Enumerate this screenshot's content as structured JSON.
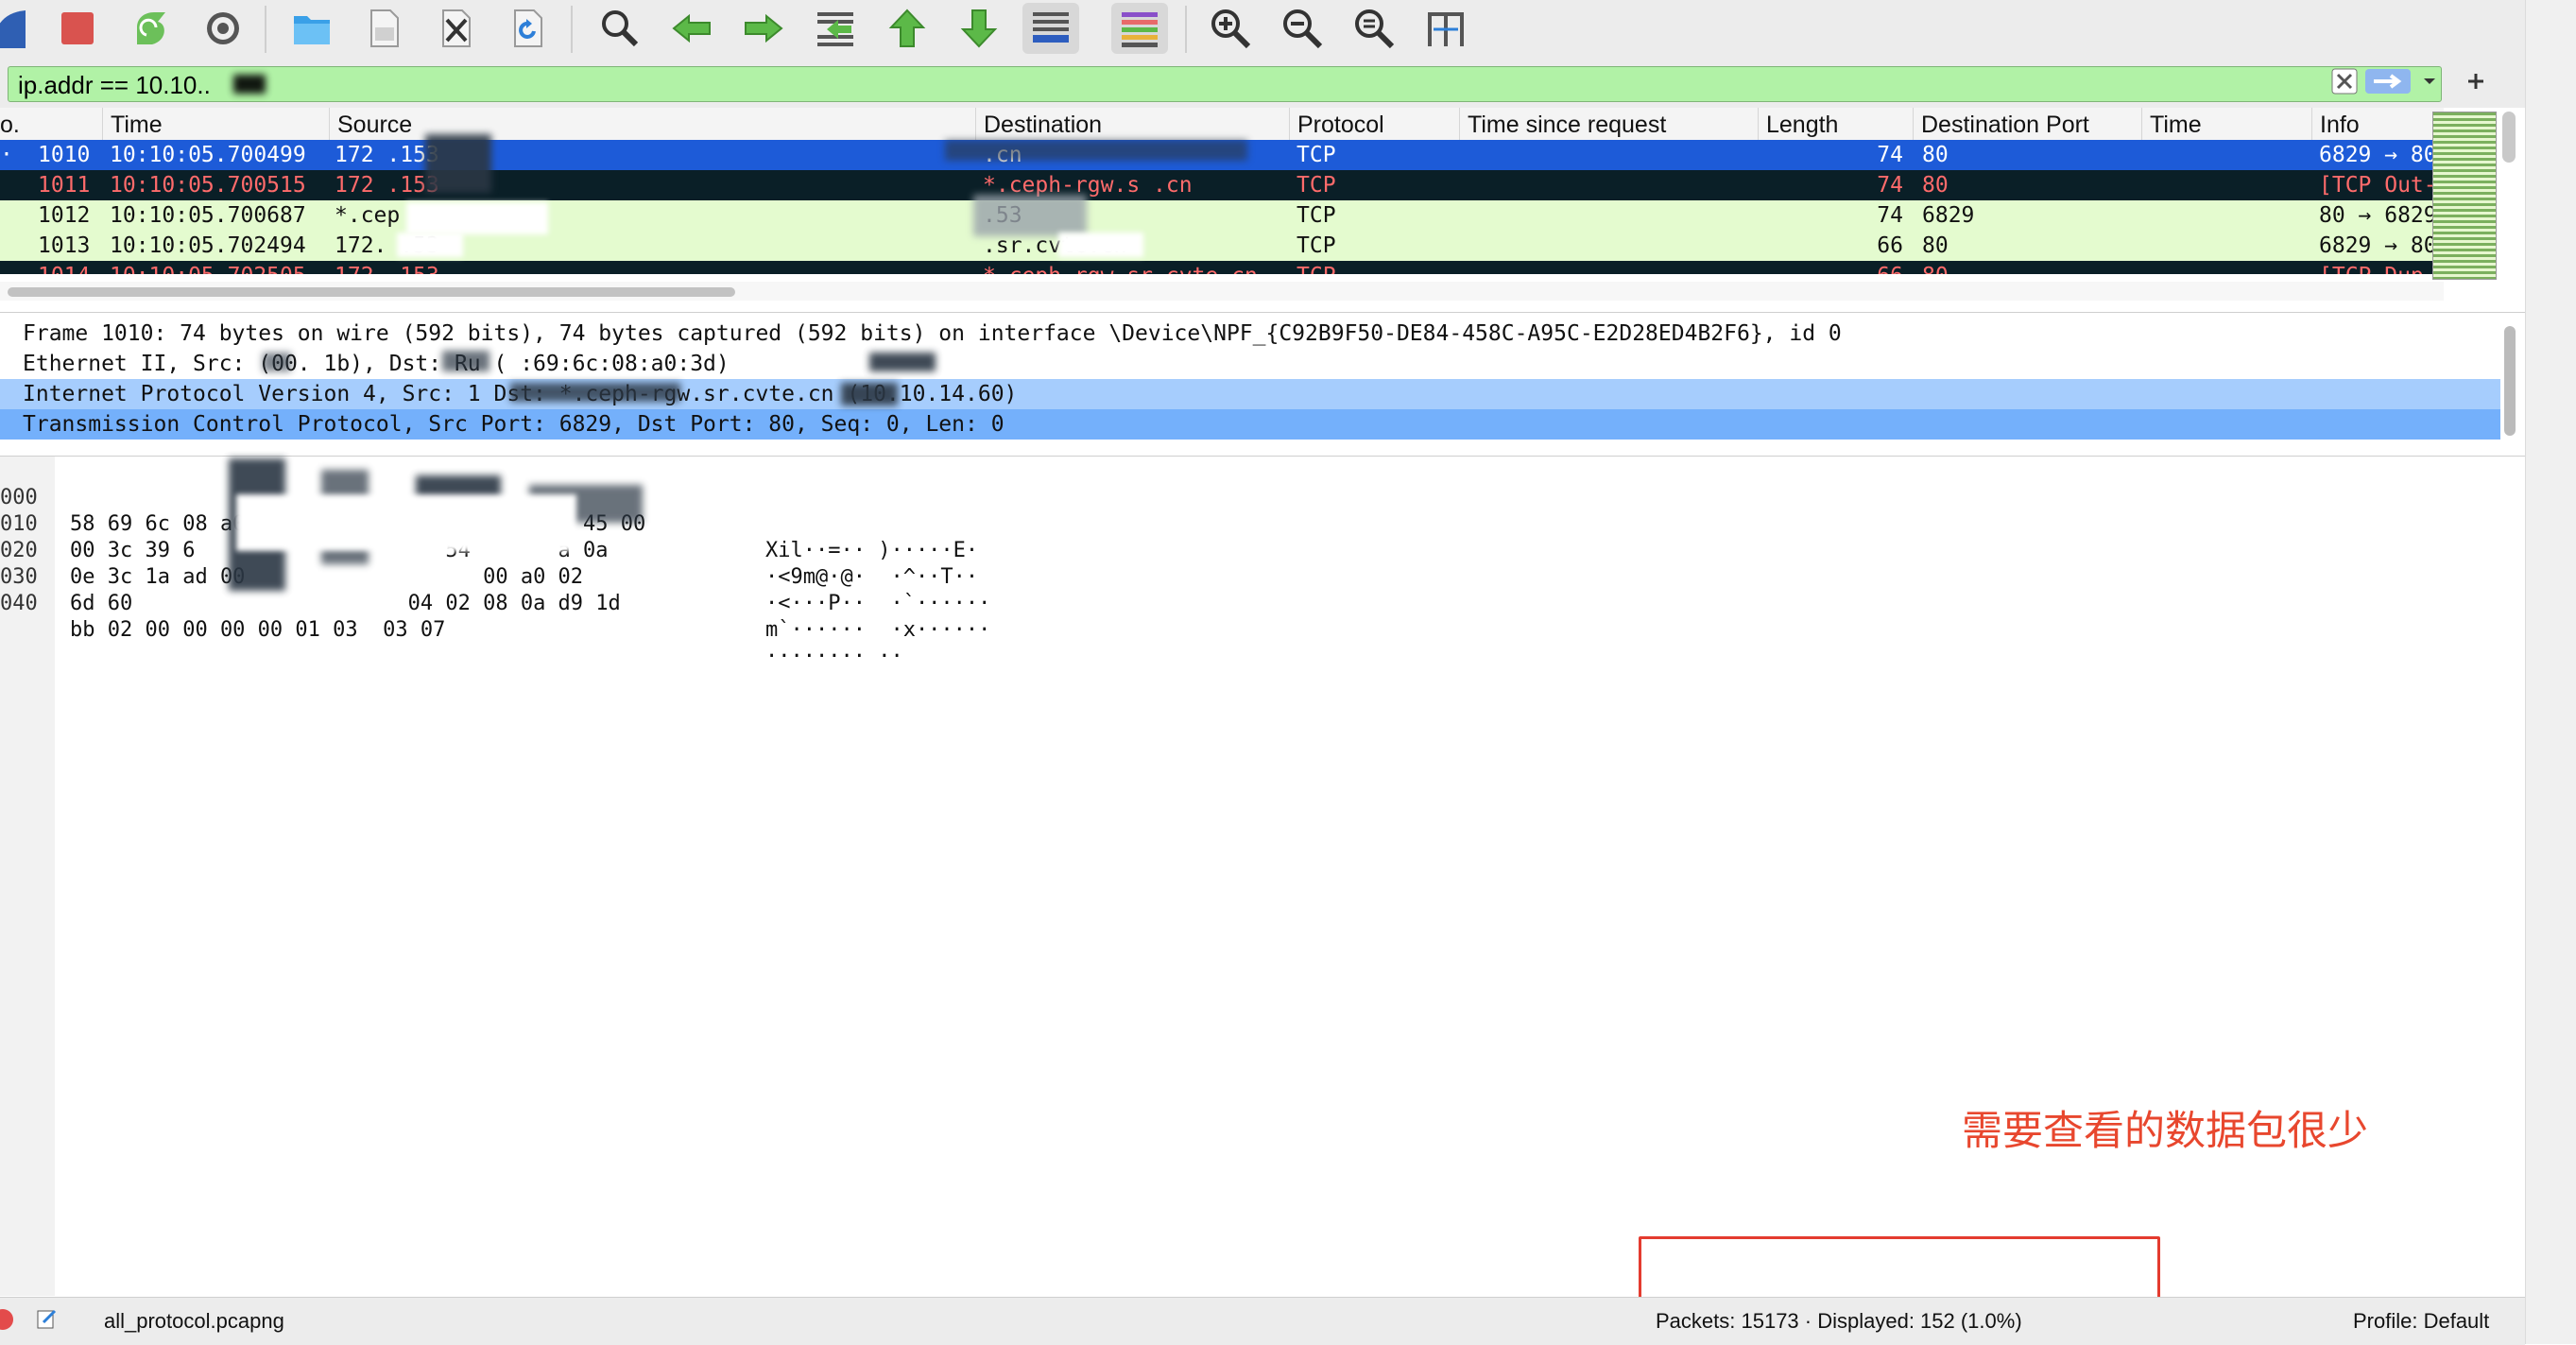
{
  "toolbar": {
    "items": [
      "shark-fin-icon",
      "stop-capture-icon",
      "restart-capture-icon",
      "capture-options-icon",
      "open-file-icon",
      "save-file-icon",
      "close-file-icon",
      "reload-file-icon",
      "find-packet-icon",
      "go-back-icon",
      "go-forward-icon",
      "go-to-packet-icon",
      "go-first-icon",
      "go-last-icon",
      "autoscroll-icon",
      "colorize-icon",
      "zoom-in-icon",
      "zoom-out-icon",
      "zoom-normal-icon",
      "resize-columns-icon"
    ]
  },
  "filter": {
    "value": "ip.addr == 10.10..",
    "bg_color": "#b1f2a6"
  },
  "packet_list": {
    "columns": [
      "o.",
      "Time",
      "Source",
      "Destination",
      "Protocol",
      "Time since request",
      "Length",
      "Destination Port",
      "Time",
      "Info"
    ],
    "rows": [
      {
        "no": "1010",
        "time": "10:10:05.700499",
        "source": "172          .153",
        "destination": "                     .cn",
        "protocol": "TCP",
        "tsr": "",
        "length": "74",
        "dport": "80",
        "time2": "",
        "info": "6829 → 80",
        "style": "selected"
      },
      {
        "no": "1011",
        "time": "10:10:05.700515",
        "source": "172          .153",
        "destination": "*.ceph-rgw.s      .cn",
        "protocol": "TCP",
        "tsr": "",
        "length": "74",
        "dport": "80",
        "time2": "",
        "info": "[TCP Out-",
        "style": "dark"
      },
      {
        "no": "1012",
        "time": "10:10:05.700687",
        "source": "*.cep",
        "destination": "            .53",
        "protocol": "TCP",
        "tsr": "",
        "length": "74",
        "dport": "6829",
        "time2": "",
        "info": "80 → 6829",
        "style": "green"
      },
      {
        "no": "1013",
        "time": "10:10:05.702494",
        "source": "172.     .53",
        "destination": "        .sr.cvte.cn",
        "protocol": "TCP",
        "tsr": "",
        "length": "66",
        "dport": "80",
        "time2": "",
        "info": "6829 → 80",
        "style": "green"
      },
      {
        "no": "1014",
        "time": "10:10:05.702505",
        "source": "172      .153",
        "destination": "*.ceph-rgw.sr.cvte.cn",
        "protocol": "TCP",
        "tsr": "",
        "length": "66",
        "dport": "80",
        "time2": "",
        "info": "[TCP Dup",
        "style": "dark"
      }
    ]
  },
  "details": {
    "rows": [
      {
        "text": "Frame 1010: 74 bytes on wire (592 bits), 74 bytes captured (592 bits) on interface \\Device\\NPF_{C92B9F50-DE84-458C-A95C-E2D28ED4B2F6}, id 0",
        "style": "none"
      },
      {
        "text": "Ethernet II, Src:        (00.      1b), Dst: Ru           (     :69:6c:08:a0:3d)",
        "style": "none"
      },
      {
        "text": "Internet Protocol Version 4, Src: 1                          Dst: *.ceph-rgw.sr.cvte.cn (10.10.14.60)",
        "style": "light"
      },
      {
        "text": "Transmission Control Protocol, Src Port: 6829, Dst Port: 80, Seq: 0, Len: 0",
        "style": "medium"
      }
    ]
  },
  "bytes": {
    "rows": [
      {
        "offset": "000",
        "hex": "58 69 6c 08 a0 3d          , bf 1b 08 00 45 00",
        "ascii": "Xil··=·· )·····E·"
      },
      {
        "offset": "010",
        "hex": "00 3c 39 6                    54       a 0a",
        "ascii": "·<9m@·@·  ·^··T··"
      },
      {
        "offset": "020",
        "hex": "0e 3c 1a ad 00                   00 a0 02",
        "ascii": "·<···P··  ·`······"
      },
      {
        "offset": "030",
        "hex": "6d 60                      04 02 08 0a d9 1d",
        "ascii": "m`······  ·x······"
      },
      {
        "offset": "040",
        "hex": "bb 02 00 00 00 00 01 03  03 07",
        "ascii": "········ ··"
      }
    ]
  },
  "annotation": {
    "note": "需要查看的数据包很少",
    "color": "#e8472e"
  },
  "status": {
    "file": "all_protocol.pcapng",
    "packets": "Packets: 15173 · Displayed: 152 (1.0%)",
    "profile": "Profile: Default"
  }
}
